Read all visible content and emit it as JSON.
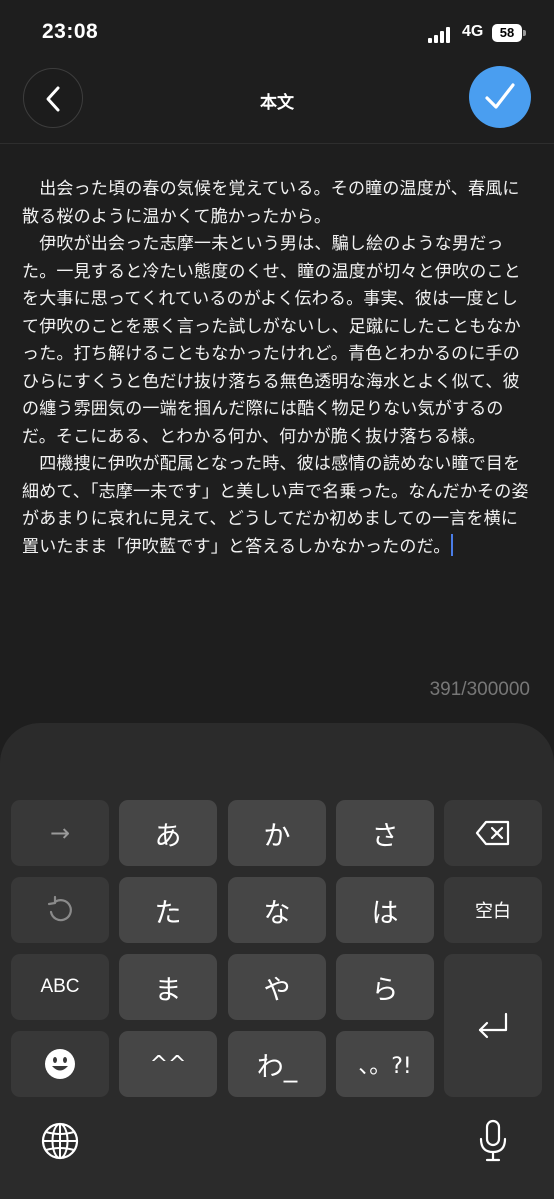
{
  "status_bar": {
    "time": "23:08",
    "network": "4G",
    "battery": "58"
  },
  "nav": {
    "title": "本文",
    "back_icon": "chevron-left-icon",
    "done_icon": "checkmark-icon",
    "done_color": "#4a9ef0"
  },
  "editor": {
    "text": "　出会った頃の春の気候を覚えている。その瞳の温度が、春風に散る桜のように温かくて脆かったから。\n　伊吹が出会った志摩一未という男は、騙し絵のような男だった。一見すると冷たい態度のくせ、瞳の温度が切々と伊吹のことを大事に思ってくれているのがよく伝わる。事実、彼は一度として伊吹のことを悪く言った試しがないし、足蹴にしたこともなかった。打ち解けることもなかったけれど。青色とわかるのに手のひらにすくうと色だけ抜け落ちる無色透明な海水とよく似て、彼の纏う雰囲気の一端を掴んだ際には酷く物足りない気がするのだ。そこにある、とわかる何か、何かが脆く抜け落ちる様。\n　四機捜に伊吹が配属となった時、彼は感情の読めない瞳で目を細めて、「志摩一未です」と美しい声で名乗った。なんだかその姿があまりに哀れに見えて、どうしてだか初めましての一言を横に置いたまま「伊吹藍です」と答えるしかなかったのだ。",
    "char_count": "391/300000",
    "caret_color": "#4a7de8"
  },
  "keyboard": {
    "row1": [
      "→",
      "あ",
      "か",
      "さ",
      "⌫"
    ],
    "row2": [
      "↺",
      "た",
      "な",
      "は",
      "空白"
    ],
    "row3": [
      "ABC",
      "ま",
      "や",
      "ら"
    ],
    "row4": [
      "☻",
      "^^",
      "わ_",
      "、。?!"
    ],
    "enter_icon": "return-icon",
    "globe_icon": "globe-icon",
    "mic_icon": "microphone-icon"
  }
}
